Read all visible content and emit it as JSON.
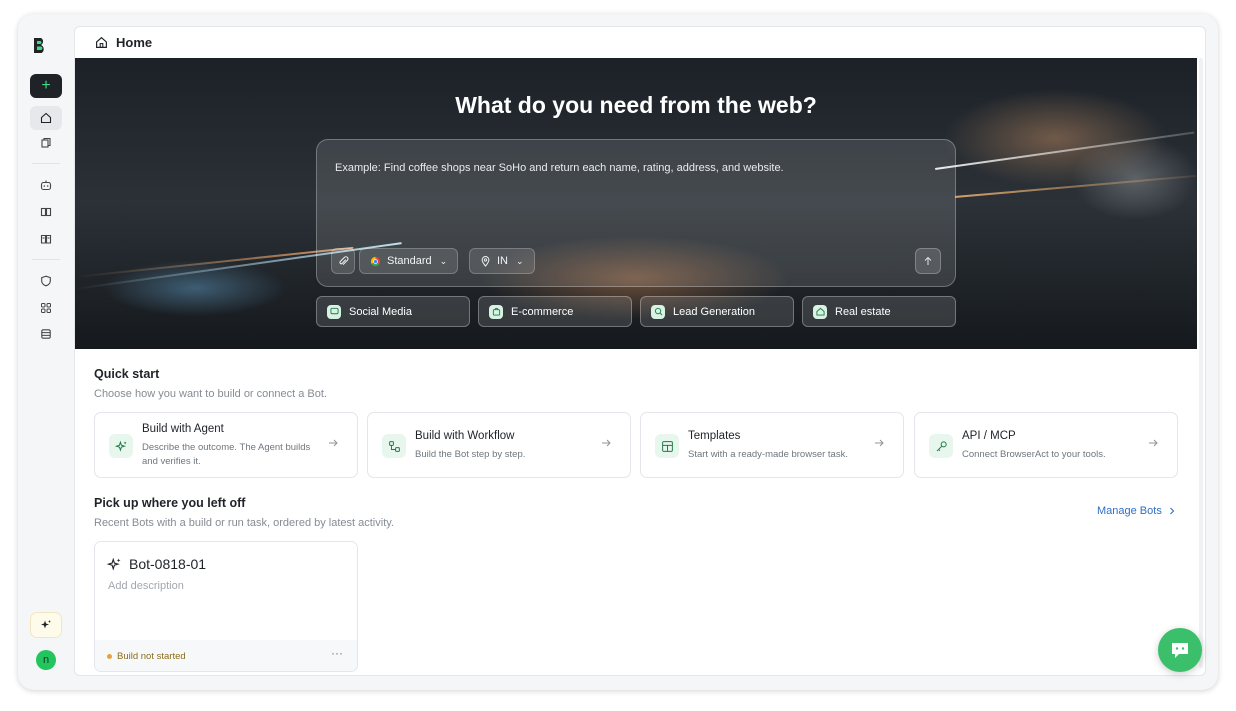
{
  "header": {
    "title": "Home"
  },
  "hero": {
    "title": "What do you need from the web?",
    "placeholder": "Example: Find coffee shops near SoHo and return each name, rating, address, and website.",
    "mode_label": "Standard",
    "region_label": "IN"
  },
  "chips": [
    {
      "label": "Social Media"
    },
    {
      "label": "E-commerce"
    },
    {
      "label": "Lead Generation"
    },
    {
      "label": "Real estate"
    }
  ],
  "quick_start": {
    "title": "Quick start",
    "subtitle": "Choose how you want to build or connect a Bot.",
    "cards": [
      {
        "title": "Build with Agent",
        "desc_line1": "Describe the outcome. The Agent builds",
        "desc_line2": "and verifies it."
      },
      {
        "title": "Build with Workflow",
        "desc_line1": "Build the Bot step by step.",
        "desc_line2": ""
      },
      {
        "title": "Templates",
        "desc_line1": "Start with a ready-made browser task.",
        "desc_line2": ""
      },
      {
        "title": "API / MCP",
        "desc_line1": "Connect BrowserAct to your tools.",
        "desc_line2": ""
      }
    ]
  },
  "recent": {
    "title": "Pick up where you left off",
    "subtitle": "Recent Bots with a build or run task, ordered by latest activity.",
    "manage_label": "Manage Bots",
    "bots": [
      {
        "name": "Bot-0818-01",
        "description": "Add description",
        "status": "Build not started",
        "more": "···"
      }
    ]
  },
  "user": {
    "avatar_initial": "n"
  },
  "colors": {
    "accent": "#3bbf6b",
    "link": "#2f6fc6",
    "sidebar_new_bg": "#1f2328"
  }
}
